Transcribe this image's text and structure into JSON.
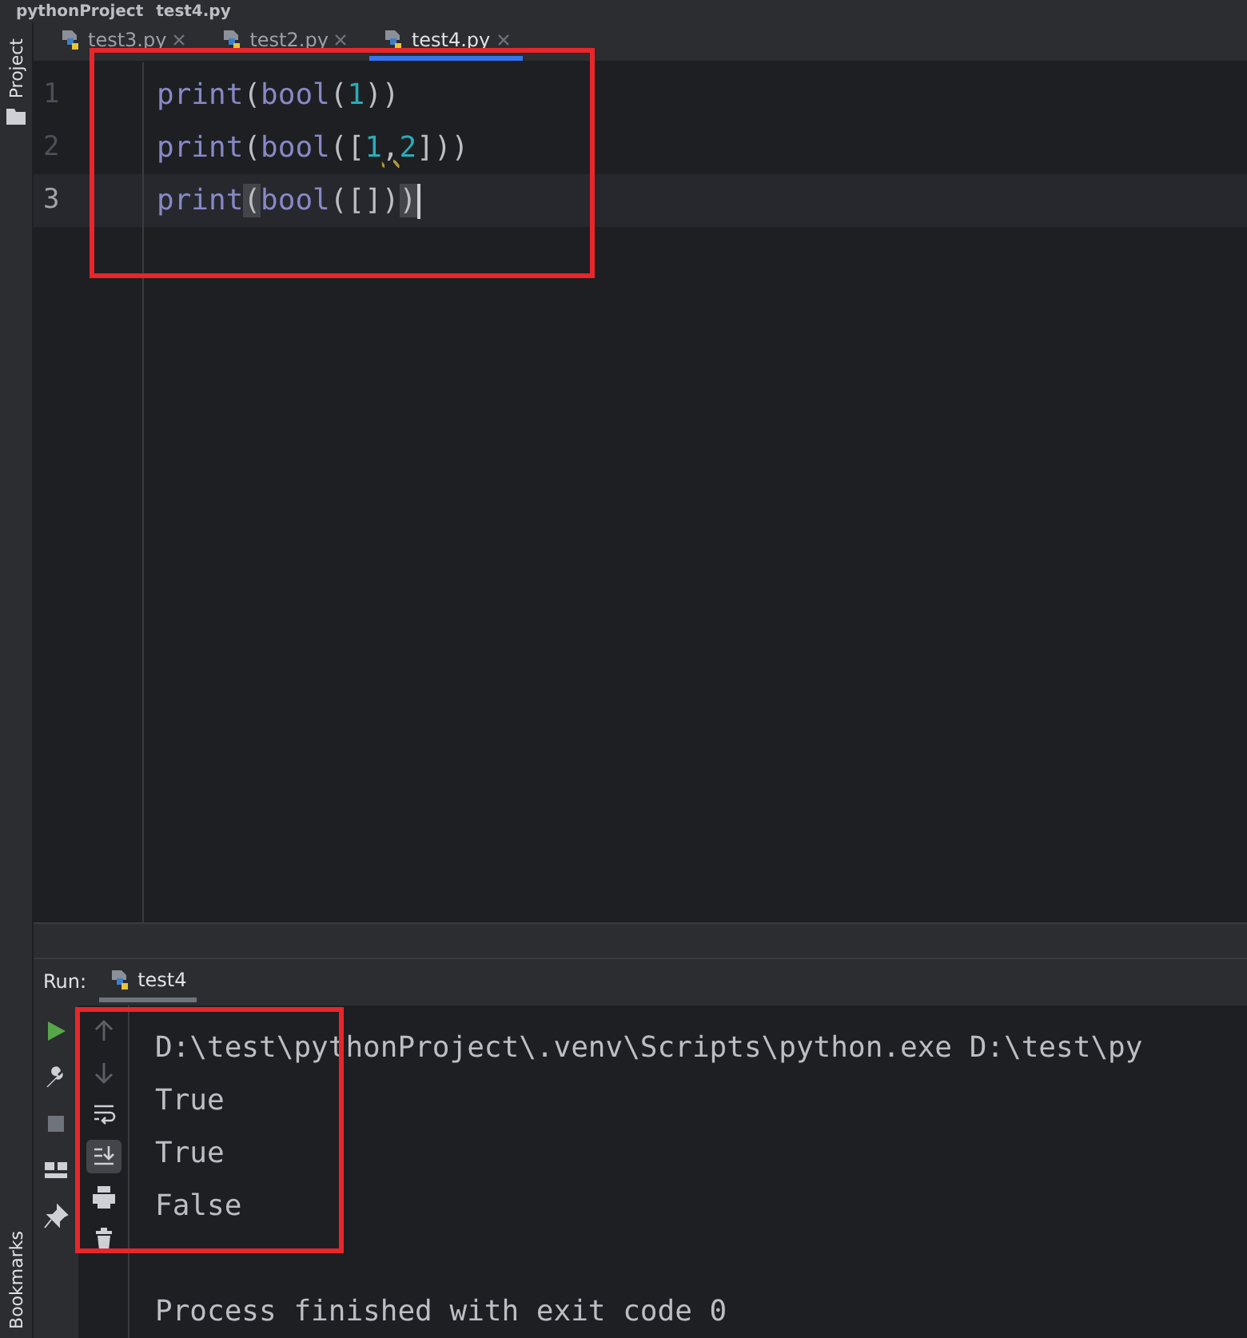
{
  "breadcrumb": [
    "pythonProject",
    "test4.py"
  ],
  "left_strip": {
    "top": "Project",
    "bottom": "Bookmarks"
  },
  "tabs": [
    {
      "label": "test3.py",
      "selected": false
    },
    {
      "label": "test2.py",
      "selected": false
    },
    {
      "label": "test4.py",
      "selected": true
    }
  ],
  "editor": {
    "lines": [
      {
        "number": "1",
        "current": false,
        "tokens": [
          {
            "text": "print",
            "kind": "builtin"
          },
          {
            "text": "(",
            "kind": "punc"
          },
          {
            "text": "bool",
            "kind": "builtin"
          },
          {
            "text": "(",
            "kind": "punc"
          },
          {
            "text": "1",
            "kind": "number"
          },
          {
            "text": "))",
            "kind": "punc"
          }
        ]
      },
      {
        "number": "2",
        "current": false,
        "tokens": [
          {
            "text": "print",
            "kind": "builtin"
          },
          {
            "text": "(",
            "kind": "punc"
          },
          {
            "text": "bool",
            "kind": "builtin"
          },
          {
            "text": "([",
            "kind": "punc"
          },
          {
            "text": "1",
            "kind": "number"
          },
          {
            "text": ",",
            "kind": "warn"
          },
          {
            "text": "2",
            "kind": "number"
          },
          {
            "text": "]))",
            "kind": "punc"
          }
        ]
      },
      {
        "number": "3",
        "current": true,
        "tokens": [
          {
            "text": "print",
            "kind": "builtin"
          },
          {
            "text": "(",
            "kind": "match"
          },
          {
            "text": "bool",
            "kind": "builtin"
          },
          {
            "text": "([])",
            "kind": "punc"
          },
          {
            "text": ")",
            "kind": "match"
          }
        ]
      }
    ]
  },
  "run": {
    "label": "Run:",
    "tab": "test4",
    "console": [
      {
        "text": "D:\\test\\pythonProject\\.venv\\Scripts\\python.exe D:\\test\\py"
      },
      {
        "text": "True"
      },
      {
        "text": "True"
      },
      {
        "text": "False"
      },
      {
        "text": "Process finished with exit code 0"
      }
    ]
  }
}
